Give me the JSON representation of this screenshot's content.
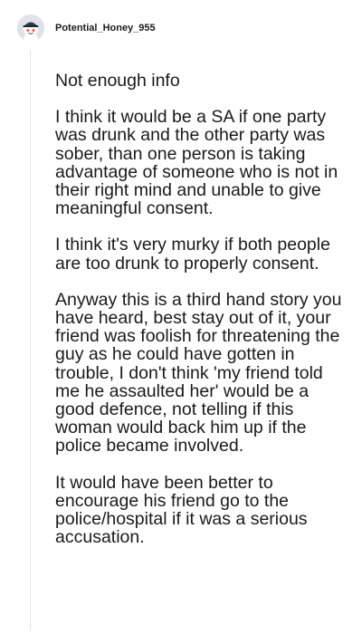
{
  "comment": {
    "author": "Potential_Honey_955",
    "avatar_icon": "reddit-snoo-avatar-icon",
    "paragraphs": [
      "Not enough info",
      "I think it would be a SA if one party was drunk and the other party was sober, than one person is taking advantage of someone who is not in their right mind and unable to give meaningful consent.",
      "I think it's very murky if both people are too drunk to properly consent.",
      "Anyway this is a third hand story you have heard, best stay out of it, your friend was foolish for threatening the guy as he could have gotten in trouble, I don't think 'my friend told me he assaulted her' would be a good defence, not telling if this woman would back him up if the police became involved.",
      "It would have been better to encourage his friend go to the police/hospital if it was a serious accusation."
    ]
  }
}
